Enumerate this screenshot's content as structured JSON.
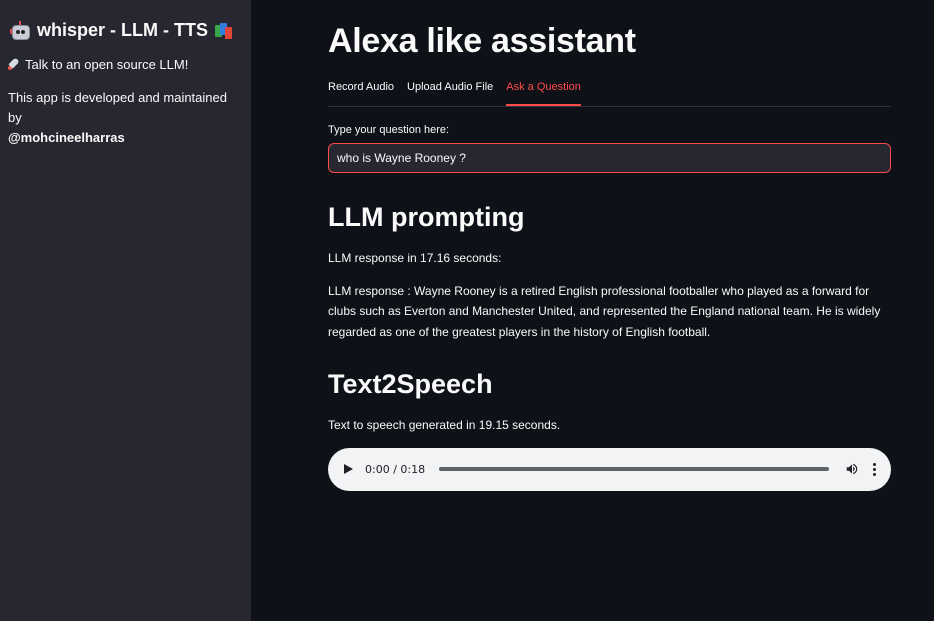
{
  "sidebar": {
    "title": "whisper - LLM - TTS",
    "tagline": "Talk to an open source LLM!",
    "dev_text": "This app is developed and maintained by",
    "author": "@mohcineelharras"
  },
  "main": {
    "title": "Alexa like assistant",
    "tabs": [
      {
        "label": "Record Audio",
        "active": false
      },
      {
        "label": "Upload Audio File",
        "active": false
      },
      {
        "label": "Ask a Question",
        "active": true
      }
    ],
    "question_label": "Type your question here:",
    "question_value": "who is Wayne Rooney ?",
    "llm_heading": "LLM prompting",
    "llm_time": "LLM response in 17.16 seconds:",
    "llm_response": "LLM response : Wayne Rooney is a retired English professional footballer who played as a forward for clubs such as Everton and Manchester United, and represented the England national team. He is widely regarded as one of the greatest players in the history of English football.",
    "tts_heading": "Text2Speech",
    "tts_time": "Text to speech generated in 19.15 seconds.",
    "audio": {
      "time": "0:00 / 0:18",
      "progress": 0.0
    }
  },
  "colors": {
    "background": "#0e1117",
    "sidebar": "#262730",
    "accent": "#ff4b4b",
    "text": "#fafafa"
  },
  "icons": [
    "robot-icon",
    "books-icon",
    "rocket-icon",
    "play-icon",
    "volume-icon",
    "more-vert-icon"
  ]
}
